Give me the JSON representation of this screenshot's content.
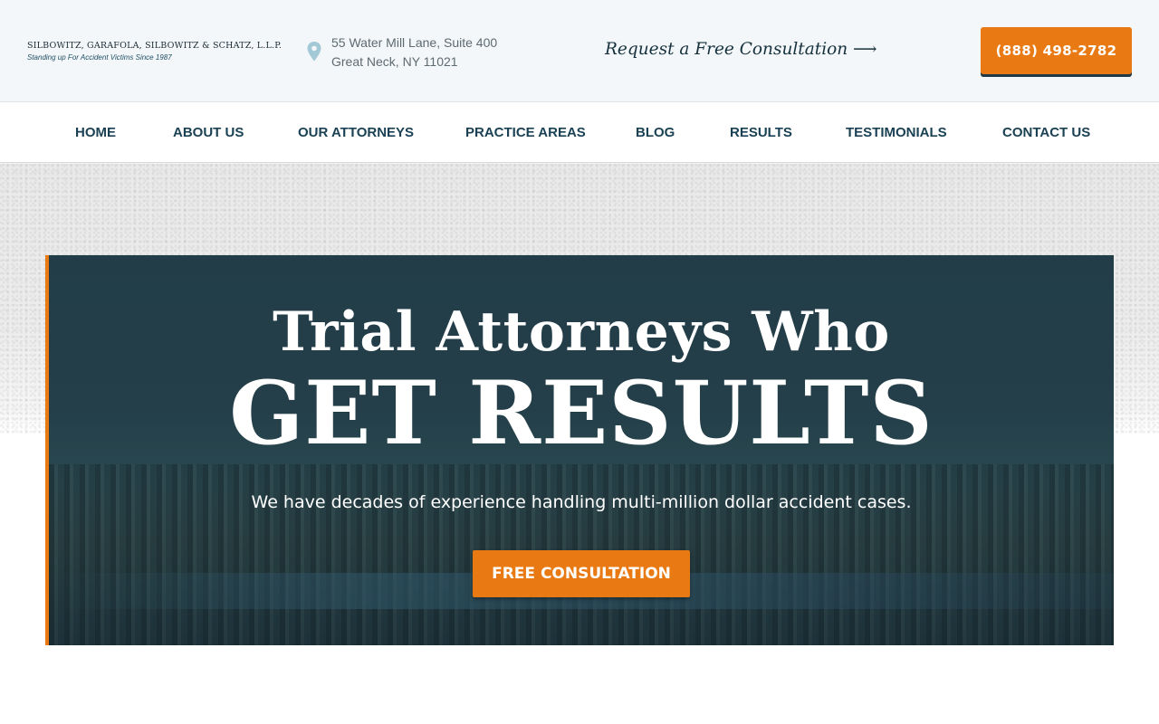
{
  "header": {
    "firm_name": "SILBOWITZ, GARAFOLA, SILBOWITZ & SCHATZ, L.L.P.",
    "tagline": "Standing up For Accident Victims Since 1987",
    "address_line1": "55 Water Mill Lane, Suite 400",
    "address_line2": "Great Neck, NY 11021",
    "consult_link": "Request a Free Consultation ⟶",
    "phone": "(888) 498-2782"
  },
  "nav": {
    "items": [
      {
        "label": "HOME"
      },
      {
        "label": "ABOUT US"
      },
      {
        "label": "OUR ATTORNEYS"
      },
      {
        "label": "PRACTICE AREAS"
      },
      {
        "label": "BLOG"
      },
      {
        "label": "RESULTS"
      },
      {
        "label": "TESTIMONIALS"
      },
      {
        "label": "CONTACT US"
      }
    ]
  },
  "hero": {
    "line1": "Trial Attorneys Who",
    "line2": "GET RESULTS",
    "subtitle": "We have decades of experience handling multi-million dollar accident cases.",
    "button": "FREE CONSULTATION"
  },
  "colors": {
    "accent": "#e87913",
    "navy": "#1a4154",
    "hero_panel": "#223d48"
  },
  "icons": {
    "address": "map-pin-icon",
    "consult": "arrow-right-icon"
  }
}
